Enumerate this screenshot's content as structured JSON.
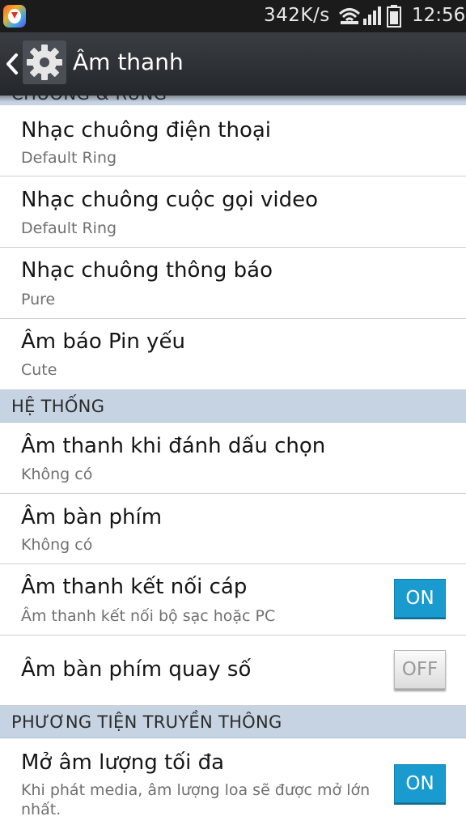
{
  "status_bar": {
    "network_speed": "342K/s",
    "time": "12:56",
    "icons": [
      "download-notification-icon",
      "wifi-icon",
      "signal-icon",
      "battery-icon"
    ]
  },
  "action_bar": {
    "title": "Âm thanh",
    "icons": [
      "back-chevron-icon",
      "gear-icon"
    ]
  },
  "partial_section": "CHUÔNG & RUNG",
  "ringtones": [
    {
      "title": "Nhạc chuông điện thoại",
      "subtitle": "Default Ring"
    },
    {
      "title": "Nhạc chuông cuộc gọi video",
      "subtitle": "Default Ring"
    },
    {
      "title": "Nhạc chuông thông báo",
      "subtitle": "Pure"
    },
    {
      "title": "Âm báo Pin yếu",
      "subtitle": "Cute"
    }
  ],
  "system": {
    "header": "HỆ THỐNG",
    "items": [
      {
        "title": "Âm thanh khi đánh dấu chọn",
        "subtitle": "Không có"
      },
      {
        "title": "Âm bàn phím",
        "subtitle": "Không có"
      },
      {
        "title": "Âm thanh kết nối cáp",
        "subtitle": "Âm thanh kết nối bộ sạc hoặc PC",
        "toggle": "ON"
      },
      {
        "title": "Âm bàn phím quay số",
        "toggle": "OFF"
      }
    ]
  },
  "media": {
    "header": "PHƯƠNG TIỆN TRUYỀN THÔNG",
    "items": [
      {
        "title": "Mở âm lượng tối đa",
        "subtitle": "Khi phát media, âm lượng loa sẽ được mở lớn nhất.",
        "toggle": "ON"
      }
    ]
  },
  "colors": {
    "section_bg": "#c6d3e2",
    "toggle_on": "#1a9bcf",
    "action_bar": "#2e3136"
  }
}
